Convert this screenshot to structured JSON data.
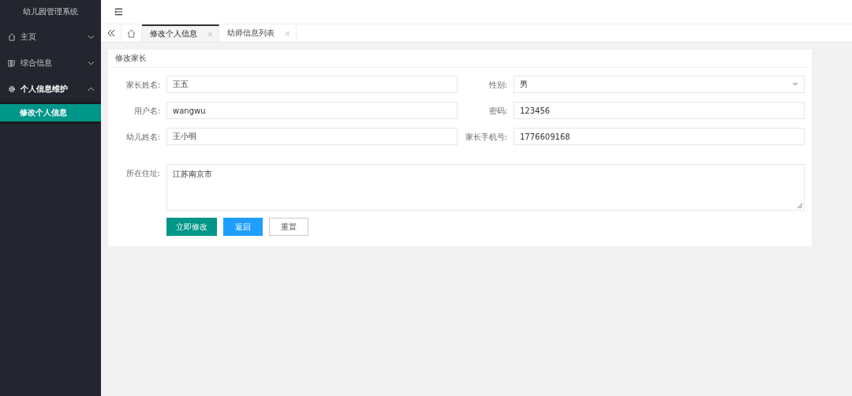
{
  "sidebar": {
    "title": "幼儿园管理系统",
    "items": [
      {
        "label": "主页",
        "kind": "home",
        "expanded": false
      },
      {
        "label": "综合信息",
        "kind": "book",
        "expanded": false
      },
      {
        "label": "个人信息维护",
        "kind": "gear",
        "expanded": true,
        "children": [
          {
            "label": "修改个人信息",
            "selected": true
          }
        ]
      }
    ]
  },
  "tabs": [
    {
      "label": "修改个人信息",
      "selected": true
    },
    {
      "label": "幼师信息列表",
      "selected": false
    }
  ],
  "form": {
    "title": "修改家长",
    "fields": [
      {
        "label": "家长姓名:",
        "value": "王五",
        "kind": "input"
      },
      {
        "label": "性别:",
        "value": "男",
        "kind": "select"
      },
      {
        "label": "用户名:",
        "value": "wangwu",
        "kind": "input"
      },
      {
        "label": "密码:",
        "value": "123456",
        "kind": "input"
      },
      {
        "label": "幼儿姓名:",
        "value": "王小明",
        "kind": "input"
      },
      {
        "label": "家长手机号:",
        "value": "1776609168",
        "kind": "input"
      },
      {
        "label": "所在住址:",
        "value": "江苏南京市",
        "kind": "textarea"
      }
    ],
    "buttons": [
      {
        "label": "立即修改",
        "kind": "primary"
      },
      {
        "label": "返回",
        "kind": "normal"
      },
      {
        "label": "重置",
        "kind": "default"
      }
    ]
  }
}
